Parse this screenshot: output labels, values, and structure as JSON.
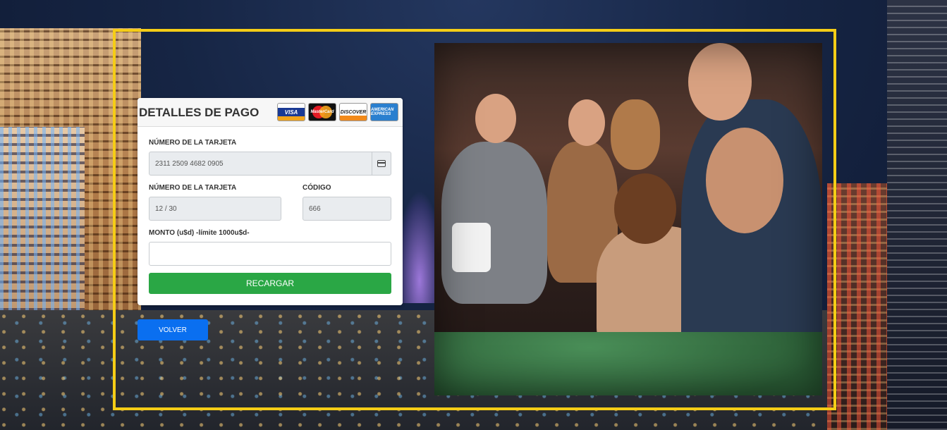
{
  "payment_form": {
    "title": "DETALLES DE PAGO",
    "card_logos": [
      "VISA",
      "MasterCard",
      "DISCOVER",
      "AMERICAN EXPRESS"
    ],
    "card_number_label": "NÚMERO DE LA TARJETA",
    "card_number_value": "2311 2509 4682 0905",
    "card_icon": "credit-card-icon",
    "expiry_label": "NÚMERO DE LA TARJETA",
    "expiry_value": "12 / 30",
    "code_label": "CÓDIGO",
    "code_value": "666",
    "amount_label": "MONTO (u$d) -límite 1000u$d-",
    "amount_value": "",
    "submit_label": "RECARGAR"
  },
  "back_button": {
    "label": "VOLVER"
  },
  "colors": {
    "frame": "#f5cd16",
    "submit": "#2aa745",
    "back": "#0a6ff0"
  }
}
